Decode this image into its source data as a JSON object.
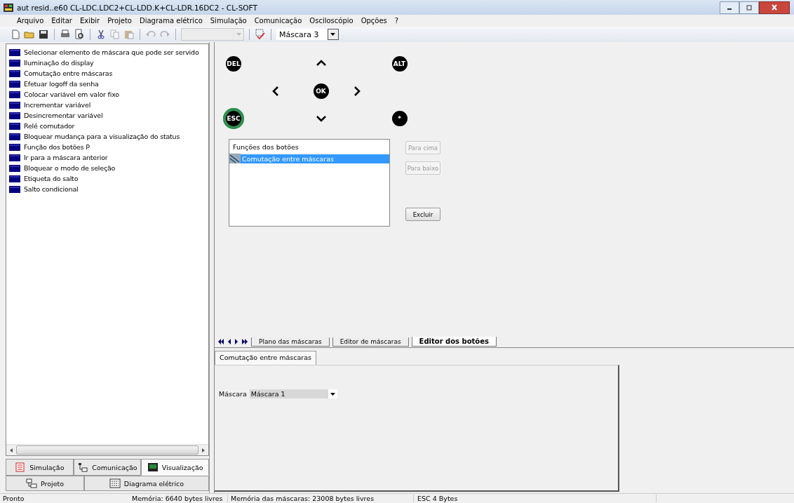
{
  "window": {
    "title": "aut resid..e60 CL-LDC.LDC2+CL-LDD.K+CL-LDR.16DC2 - CL-SOFT"
  },
  "menu": [
    "Arquivo",
    "Editar",
    "Exibir",
    "Projeto",
    "Diagrama elétrico",
    "Simulação",
    "Comunicação",
    "Osciloscópio",
    "Opções",
    "?"
  ],
  "toolbar": {
    "combo_left": {
      "disabled": true
    },
    "mask_combo": {
      "value": "Máscara 3"
    }
  },
  "element_list": [
    "Selecionar elemento de máscara que pode ser servido",
    "Iluminação do display",
    "Comutação entre máscaras",
    "Efetuar logoff da senha",
    "Colocar variável em valor fixo",
    "Incrementar variável",
    "Desincrementar variável",
    "Relé comutador",
    "Bloquear mudança para a visualização do status",
    "Função dos botões P",
    "Ir para a máscara anterior",
    "Bloquear o modo de seleção",
    "Etiqueta do salto",
    "Salto condicional"
  ],
  "left_tabs": [
    {
      "label": "Simulação",
      "selected": false,
      "kind": "sim"
    },
    {
      "label": "Comunicação",
      "selected": false,
      "kind": "com"
    },
    {
      "label": "Visualização",
      "selected": true,
      "kind": "vis"
    }
  ],
  "left_tabs_row2": [
    {
      "label": "Projeto",
      "kind": "proj"
    },
    {
      "label": "Diagrama elétrico",
      "kind": "diag"
    }
  ],
  "keypad": [
    {
      "kind": "label",
      "label": "DEL",
      "selected": false
    },
    {
      "kind": "up",
      "selected": false
    },
    {
      "kind": "label",
      "label": "ALT",
      "selected": false
    },
    {
      "kind": "left",
      "selected": false
    },
    {
      "kind": "label",
      "label": "OK",
      "selected": false
    },
    {
      "kind": "right",
      "selected": false
    },
    {
      "kind": "label",
      "label": "ESC",
      "selected": true
    },
    {
      "kind": "down",
      "selected": false
    },
    {
      "kind": "label",
      "label": "*",
      "selected": false
    }
  ],
  "functions": {
    "header": "Funções dos botões",
    "rows": [
      {
        "label": "Comutação entre máscaras",
        "selected": true
      }
    ]
  },
  "side_buttons": [
    {
      "label": "Para cima",
      "disabled": true
    },
    {
      "label": "Para baixo",
      "disabled": true
    },
    {
      "label": "Excluir",
      "disabled": false
    }
  ],
  "sheet_tabs": [
    {
      "label": "Plano das máscaras",
      "selected": false
    },
    {
      "label": "Editor de máscaras",
      "selected": false
    },
    {
      "label": "Editor dos botões",
      "selected": true
    }
  ],
  "properties": {
    "tab": "Comutação entre máscaras",
    "field_label": "Máscara",
    "field_value": "Máscara 1"
  },
  "status_bar": [
    "Pronto",
    "Memória: 6640 bytes livres",
    "Memória das máscaras: 23008 bytes livres",
    "ESC  4 Bytes"
  ]
}
